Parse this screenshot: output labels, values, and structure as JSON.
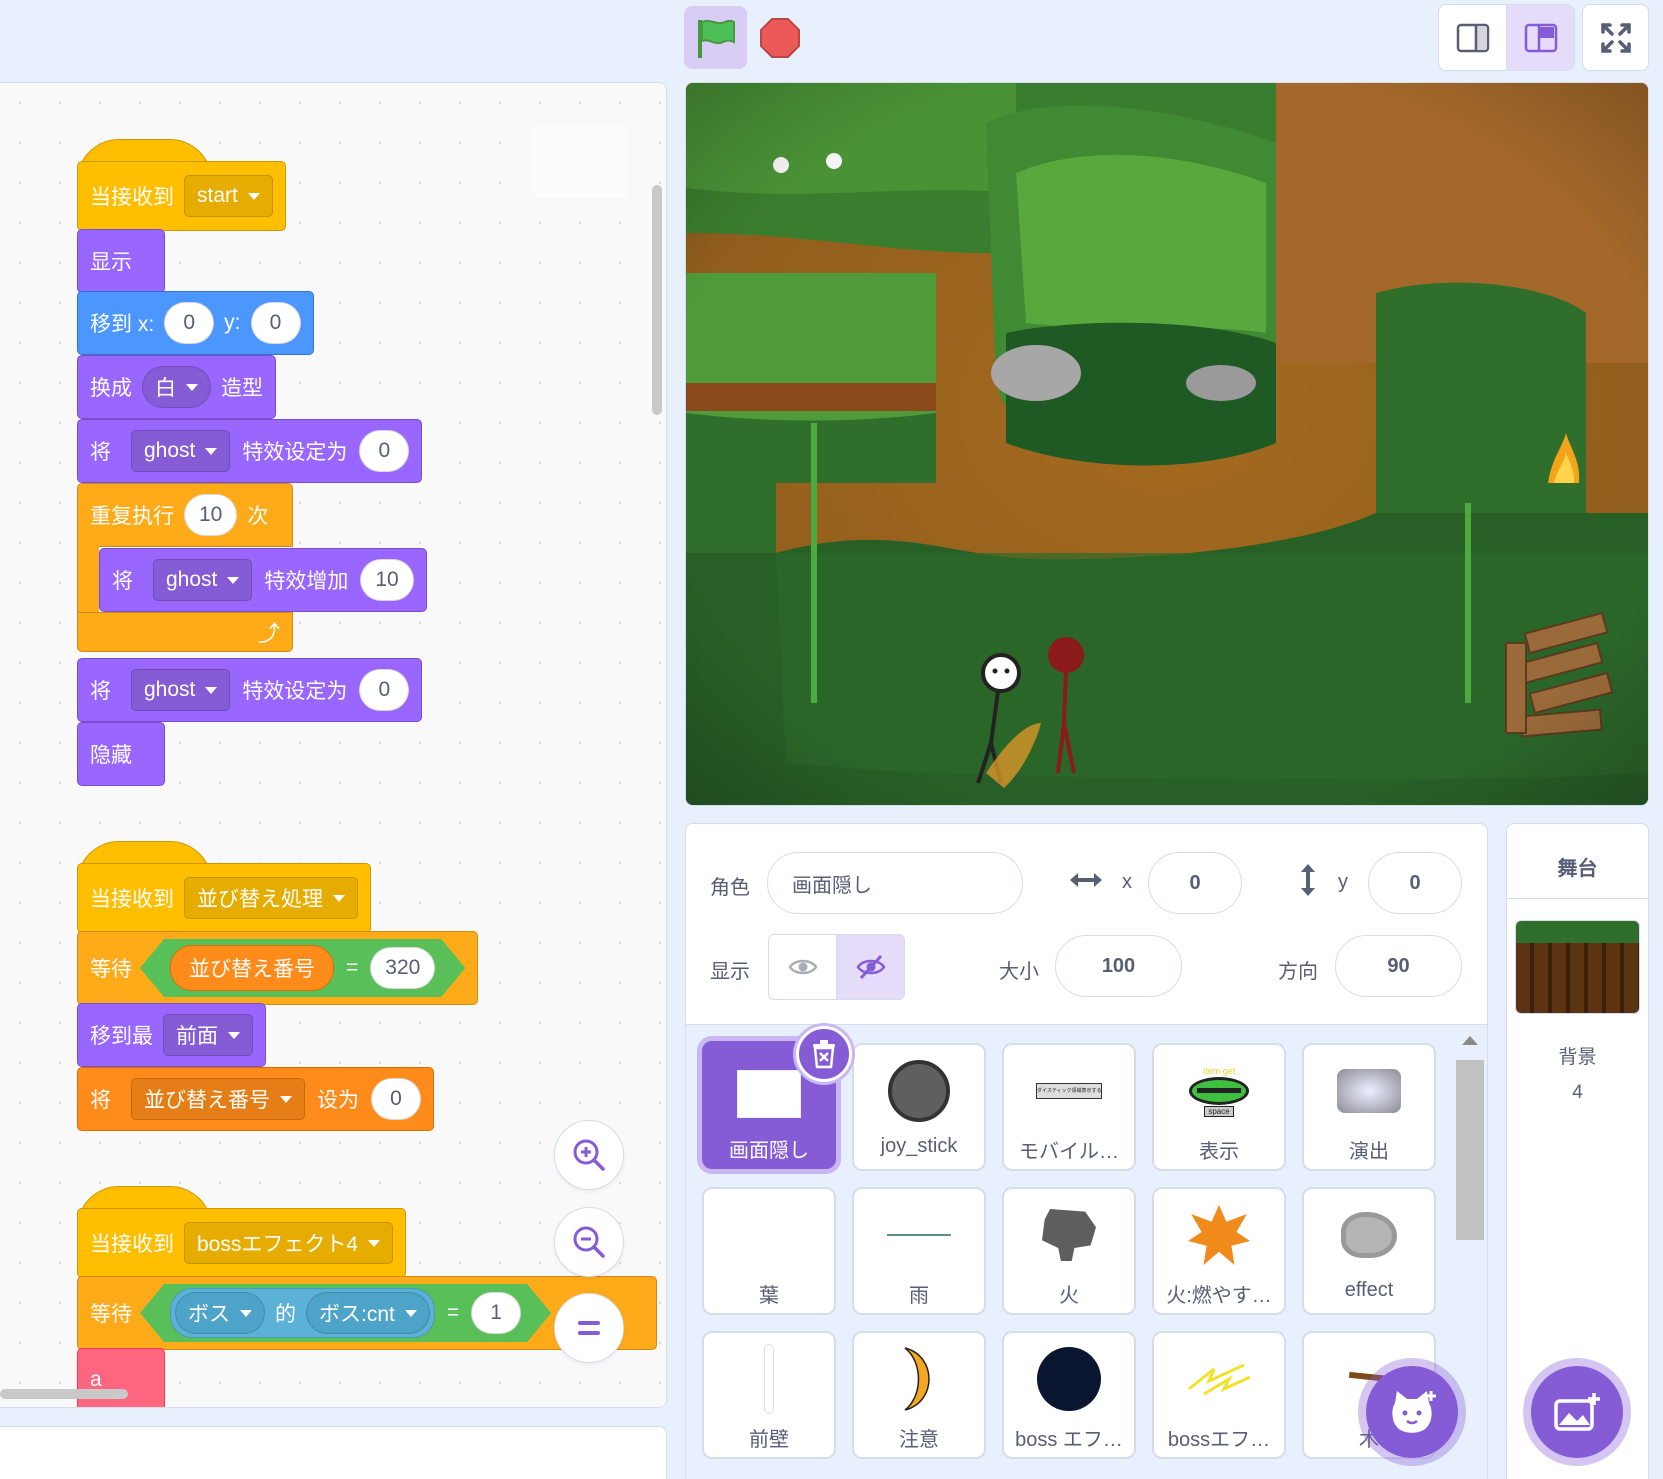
{
  "icons": {
    "green_flag": "green-flag-icon",
    "stop": "stop-sign-icon",
    "small_stage": "small-stage-icon",
    "large_stage": "large-stage-icon",
    "fullscreen": "fullscreen-icon",
    "zoom_in": "zoom-in-icon",
    "zoom_out": "zoom-out-icon",
    "zoom_reset": "zoom-reset-icon"
  },
  "colors": {
    "events": "#ffbf00",
    "looks": "#9966ff",
    "motion": "#4c97ff",
    "control": "#ffab19",
    "operators": "#59c059",
    "variables": "#ff8c1a",
    "custom": "#ff6680",
    "accent": "#855cd6"
  },
  "script1": {
    "hat_label": "当接收到",
    "hat_message": "start",
    "show": "显示",
    "goto_label": "移到 x:",
    "goto_x": "0",
    "goto_y_label": "y:",
    "goto_y": "0",
    "switch_label": "换成",
    "switch_costume": "白",
    "switch_suffix": "造型",
    "set_label": "将",
    "set_effect": "ghost",
    "set_suffix": "特效设定为",
    "set_value": "0",
    "repeat_label": "重复执行",
    "repeat_count": "10",
    "repeat_suffix": "次",
    "change_label": "将",
    "change_effect": "ghost",
    "change_suffix": "特效增加",
    "change_value": "10",
    "set2_label": "将",
    "set2_effect": "ghost",
    "set2_suffix": "特效设定为",
    "set2_value": "0",
    "hide": "隐藏"
  },
  "script2": {
    "hat_label": "当接收到",
    "hat_message": "並び替え処理",
    "wait_label": "等待",
    "var_name": "並び替え番号",
    "eq": "=",
    "compare_value": "320",
    "front_label": "移到最",
    "front_value": "前面",
    "set_label": "将",
    "set_var": "並び替え番号",
    "set_suffix": "设为",
    "set_value": "0"
  },
  "script3": {
    "hat_label": "当接收到",
    "hat_message": "bossエフェクト4",
    "wait_label": "等待",
    "of_object": "ボス",
    "of_label": "的",
    "of_property": "ボス:cnt",
    "eq": "=",
    "compare_value": "1",
    "custom_label": "a"
  },
  "sprite_info": {
    "sprite_label": "角色",
    "sprite_name": "画面隠し",
    "x_label": "x",
    "x_value": "0",
    "y_label": "y",
    "y_value": "0",
    "show_label": "显示",
    "size_label": "大小",
    "size_value": "100",
    "direction_label": "方向",
    "direction_value": "90"
  },
  "sprites": [
    {
      "name": "画面隠し",
      "selected": true
    },
    {
      "name": "joy_stick"
    },
    {
      "name": "モバイル…"
    },
    {
      "name": "表示"
    },
    {
      "name": "演出"
    },
    {
      "name": "葉"
    },
    {
      "name": "雨"
    },
    {
      "name": "火"
    },
    {
      "name": "火:燃やす…"
    },
    {
      "name": "effect"
    },
    {
      "name": "前壁"
    },
    {
      "name": "注意"
    },
    {
      "name": "boss エフ…"
    },
    {
      "name": "bossエフ…"
    },
    {
      "name": "木"
    }
  ],
  "thumb_text": {
    "mobile": "ダイスティック領域表示する (モバイル)",
    "show_top": "Item get",
    "show_key": "space"
  },
  "stage_pane": {
    "title": "舞台",
    "backdrops_label": "背景",
    "backdrops_count": "4"
  }
}
